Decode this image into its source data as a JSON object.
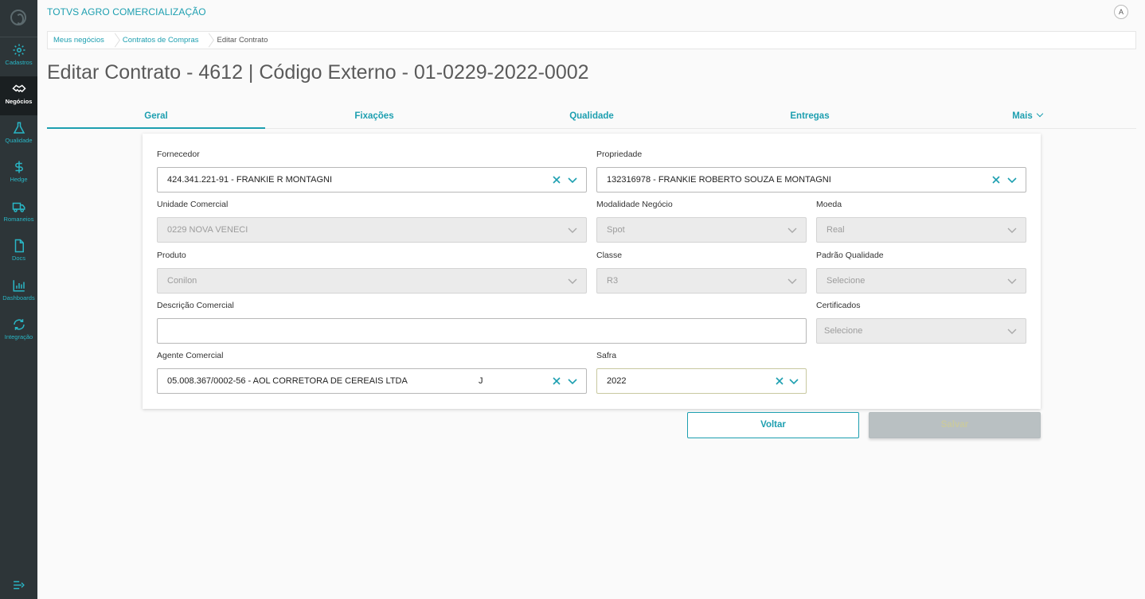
{
  "app": {
    "title": "TOTVS AGRO COMERCIALIZAÇÃO",
    "user_initial": "A"
  },
  "sidebar": {
    "items": [
      {
        "label": "Cadastros",
        "icon": "gear-icon"
      },
      {
        "label": "Negócios",
        "icon": "handshake-icon",
        "active": true
      },
      {
        "label": "Qualidade",
        "icon": "flask-icon"
      },
      {
        "label": "Hedge",
        "icon": "dollar-icon"
      },
      {
        "label": "Romaneios",
        "icon": "truck-icon"
      },
      {
        "label": "Docs",
        "icon": "document-icon"
      },
      {
        "label": "Dashboards",
        "icon": "bar-chart-icon"
      },
      {
        "label": "Integração",
        "icon": "sync-icon"
      }
    ],
    "collapse_icon": "menu-collapse-icon"
  },
  "breadcrumb": [
    "Meus negócios",
    "Contratos de Compras",
    "Editar Contrato"
  ],
  "page_title": "Editar Contrato - 4612 | Código Externo - 01-0229-2022-0002",
  "tabs": [
    "Geral",
    "Fixações",
    "Qualidade",
    "Entregas",
    "Mais"
  ],
  "form": {
    "fornecedor": {
      "label": "Fornecedor",
      "value": "424.341.221-91 - FRANKIE R MONTAGNI"
    },
    "propriedade": {
      "label": "Propriedade",
      "value": "132316978 - FRANKIE ROBERTO SOUZA E MONTAGNI"
    },
    "unidade_comercial": {
      "label": "Unidade Comercial",
      "value": "0229 NOVA VENECI"
    },
    "modalidade_negocio": {
      "label": "Modalidade Negócio",
      "value": "Spot"
    },
    "moeda": {
      "label": "Moeda",
      "value": "Real"
    },
    "produto": {
      "label": "Produto",
      "value": "Conilon"
    },
    "classe": {
      "label": "Classe",
      "value": "R3"
    },
    "padrao_qualidade": {
      "label": "Padrão Qualidade",
      "value": "Selecione"
    },
    "descricao_comercial": {
      "label": "Descrição Comercial",
      "value": ""
    },
    "certificados": {
      "label": "Certificados",
      "value": "Selecione"
    },
    "agente_comercial": {
      "label": "Agente Comercial",
      "value": "05.008.367/0002-56 - AOL CORRETORA DE CEREAIS LTDA",
      "extra": "J"
    },
    "safra": {
      "label": "Safra",
      "value": "2022"
    }
  },
  "buttons": {
    "back": "Voltar",
    "save": "Salvar"
  },
  "colors": {
    "accent": "#1d9fb0",
    "sidebar": "#2d3538",
    "highlight": "#ffff00"
  }
}
